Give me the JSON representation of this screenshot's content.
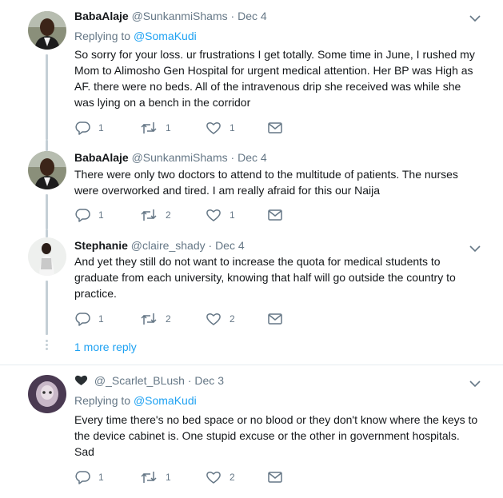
{
  "tweets": [
    {
      "name": "BabaAlaje",
      "handle": "@SunkanmiShams",
      "dot": "·",
      "time": "Dec 4",
      "replying_prefix": "Replying to ",
      "replying_mention": "@SomaKudi",
      "text": "So sorry for your loss. ur frustrations I get totally. Some time in June, I rushed my Mom to Alimosho Gen Hospital for urgent medical attention. Her BP was High as AF. there were no beds. All of the intravenous drip she received was while she was lying on a bench in the corridor",
      "replies": "1",
      "retweets": "1",
      "likes": "1"
    },
    {
      "name": "BabaAlaje",
      "handle": "@SunkanmiShams",
      "dot": "·",
      "time": "Dec 4",
      "text": "There were only two doctors to attend to the multitude of patients. The nurses were overworked and tired. I am really afraid for this our Naija",
      "replies": "1",
      "retweets": "2",
      "likes": "1"
    },
    {
      "name": "Stephanie",
      "handle": "@claire_shady",
      "dot": "·",
      "time": "Dec 4",
      "text": "And yet they still do not want to increase the quota for medical students to graduate from each university, knowing that half will go outside the country to practice.",
      "replies": "1",
      "retweets": "2",
      "likes": "2"
    },
    {
      "name": "",
      "handle": "@_Scarlet_BLush",
      "dot": "·",
      "time": "Dec 3",
      "replying_prefix": "Replying to ",
      "replying_mention": "@SomaKudi",
      "text": "Every time there's no bed space or no blood or they don't know where the keys to the device cabinet is. One stupid excuse or the other in government hospitals. Sad",
      "replies": "1",
      "retweets": "1",
      "likes": "2"
    }
  ],
  "more_reply": "1 more reply",
  "colors": {
    "link": "#1da1f2",
    "muted": "#657786",
    "thread_line": "#c4cfd6",
    "text": "#14171a"
  },
  "icons": [
    "reply-icon",
    "retweet-icon",
    "like-icon",
    "message-icon",
    "chevron-down-icon",
    "heart-emoji-icon"
  ]
}
